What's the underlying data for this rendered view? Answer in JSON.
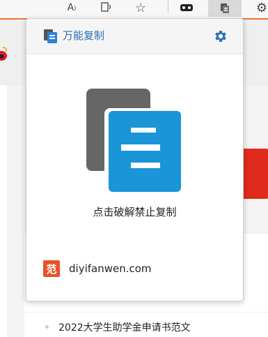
{
  "toolbar": {
    "read_aloud_glyph": "A",
    "icons": [
      "read-aloud-icon",
      "audio-icon",
      "favorite-star-icon",
      "extension-icon",
      "copy-extension-icon",
      "settings-icon"
    ]
  },
  "popup": {
    "title": "万能复制",
    "action_label": "点击破解禁止复制",
    "footer": {
      "badge": "范",
      "site": "diyifanwen.com"
    }
  },
  "background_page": {
    "link_text": "2022大学生助学金申请书范文"
  },
  "colors": {
    "accent": "#2b6fb5",
    "logo_blue": "#1a95d8",
    "logo_gray": "#666666",
    "badge_orange": "#e8512a",
    "toolbar_underline": "#e8742f",
    "page_red": "#e02a1c"
  }
}
